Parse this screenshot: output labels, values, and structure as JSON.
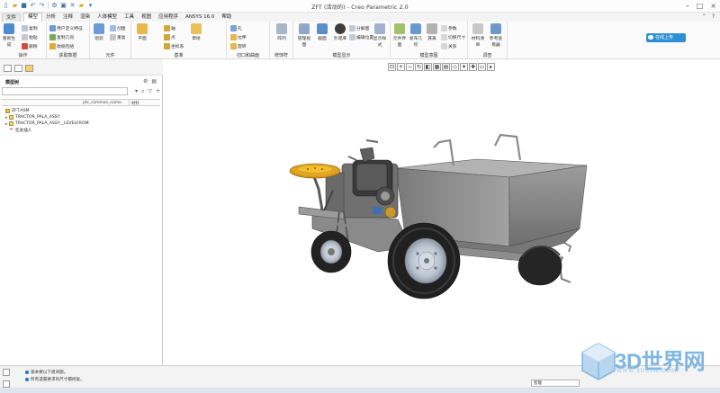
{
  "window": {
    "title": "ZFT (活动的) - Creo Parametric 2.0",
    "controls": [
      "–",
      "□",
      "×"
    ]
  },
  "tabs": {
    "file": "文件",
    "items": [
      "模型",
      "分析",
      "注释",
      "渲染",
      "人体模型",
      "工具",
      "视图",
      "应用程序",
      "ANSYS 16.0",
      "帮助"
    ],
    "active_index": 0
  },
  "ribbon": {
    "groups": [
      {
        "label": "操作",
        "buttons": [
          "重新生成",
          "复制",
          "粘贴",
          "删除"
        ]
      },
      {
        "label": "获取数据",
        "buttons": [
          "用户定义特征",
          "复制几何",
          "收缩包络"
        ]
      },
      {
        "label": "元件",
        "buttons": [
          "组装",
          "创建",
          "重复"
        ]
      },
      {
        "label": "基准",
        "buttons": [
          "平面",
          "轴",
          "点",
          "坐标系",
          "草绘"
        ]
      },
      {
        "label": "切口和曲面",
        "buttons": [
          "孔",
          "拉伸",
          "旋转"
        ]
      },
      {
        "label": "修饰符",
        "buttons": [
          "阵列"
        ]
      },
      {
        "label": "模型显示",
        "buttons": [
          "管理视图",
          "截面",
          "外观库",
          "分解图",
          "编辑位置",
          "显示样式"
        ]
      },
      {
        "label": "模型意图",
        "buttons": [
          "元件界面",
          "发布几何",
          "族表",
          "参数",
          "切换尺寸",
          "关系"
        ]
      },
      {
        "label": "调查",
        "buttons": [
          "材料清单",
          "参考查看器"
        ]
      }
    ],
    "online_button": "在线上传"
  },
  "model_tree": {
    "title": "模型树",
    "columns": [
      "ptc_common_name",
      "材料"
    ],
    "items": [
      {
        "label": "ZFT.ASM",
        "level": 0,
        "kind": "asm"
      },
      {
        "label": "TRACTOR_PALA_ASSY",
        "level": 1,
        "kind": "part"
      },
      {
        "label": "TRACTOR_PALA_ASSY__LEVELFROM",
        "level": 1,
        "kind": "part"
      },
      {
        "label": "在此插入",
        "level": 1,
        "kind": "insert"
      }
    ]
  },
  "status": {
    "messages": [
      "基本要以下组间题。",
      "所有遗漏要求的尺寸都修复。"
    ],
    "filter_value": "智能"
  },
  "watermark": {
    "text": "3D世界网",
    "sub": "WWW.3DSJW.COM"
  }
}
